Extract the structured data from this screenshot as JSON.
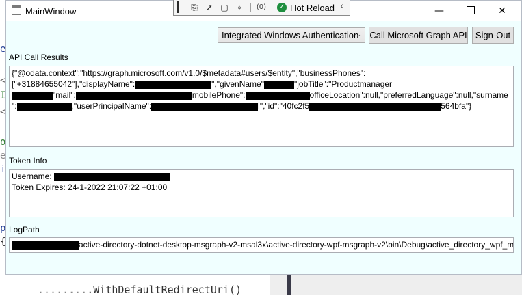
{
  "window": {
    "title": "MainWindow",
    "minimize": "—",
    "close": "✕"
  },
  "hot_reload": {
    "label": "Hot Reload",
    "collapse": "‹"
  },
  "auth": {
    "selected": "Integrated Windows Authentication",
    "arrow": "⌄"
  },
  "buttons": {
    "call_graph": "Call Microsoft Graph API",
    "sign_out": "Sign-Out"
  },
  "sections": {
    "api_label": "API Call Results",
    "api_line1": "{\"@odata.context\":\"https://graph.microsoft.com/v1.0/$metadata#users/$entity\",\"businessPhones\":",
    "api_line2a": "[\"+31884655042\"],\"displayName\":",
    "api_line2b": "\",\"givenName\"",
    "api_line2c": "\"jobTitle\":\"Productmanager",
    "api_line3a": "\"mail\":",
    "api_line3b": "mobilePhone\":",
    "api_line3c": "officeLocation\":null,\"preferredLanguage\":null,\"surname",
    "api_line4a": "\":",
    "api_line4b": ",\"userPrincipalName\":",
    "api_line4c": "l\",\"id\":\"40fc2f5",
    "api_line4d": "564bfa\"}",
    "token_label": "Token Info",
    "token_username": "Username:",
    "token_expires": "Token Expires: 24-1-2022 21:07:22 +01:00",
    "log_label": "LogPath",
    "log_path": "active-directory-dotnet-desktop-msgraph-v2-msal3x\\active-directory-wpf-msgraph-v2\\bin\\Debug\\active_directory_wpf_m"
  },
  "editor": {
    "bottom_code": ".WithDefaultRedirectUri()"
  },
  "icons": [
    "app-window-icon",
    "select-element-icon",
    "inspect-cursor-icon",
    "display-adorners-icon",
    "track-focus-icon",
    "binding-failures-icon",
    "hot-reload-check-icon",
    "collapse-toolbar-icon"
  ]
}
